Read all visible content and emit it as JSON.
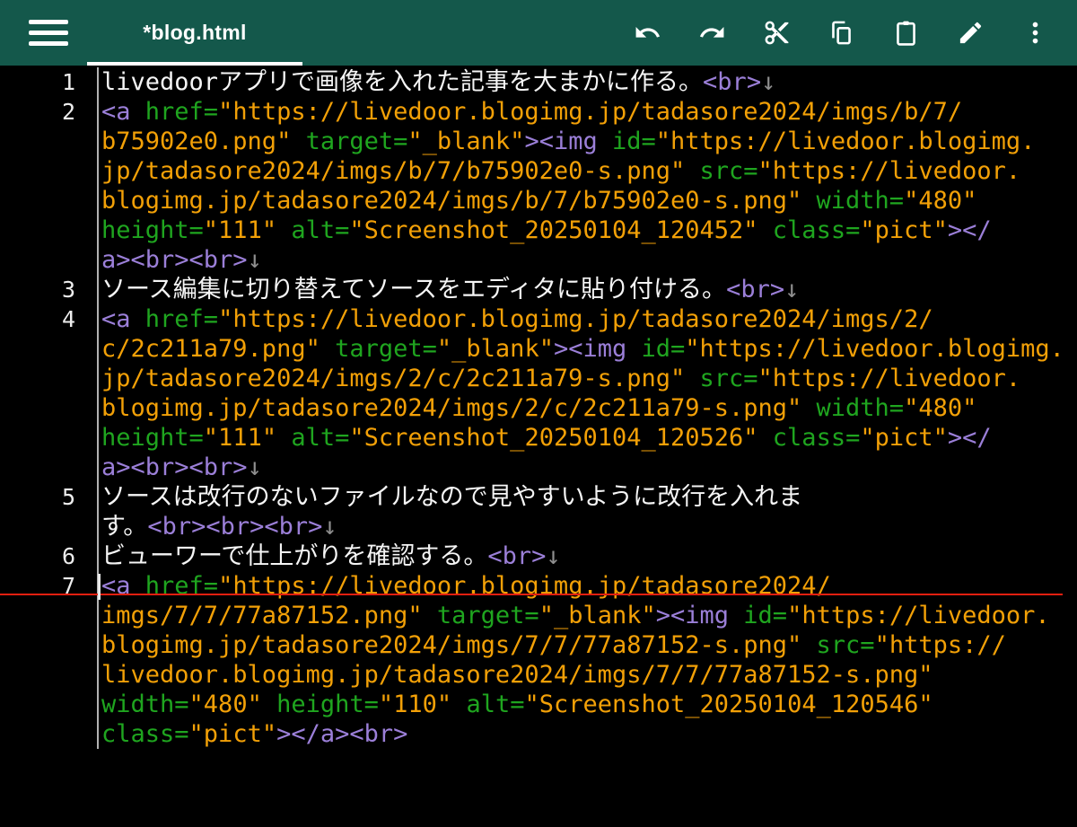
{
  "topbar": {
    "tab_title": "*blog.html",
    "icons": [
      "hamburger-menu",
      "undo",
      "redo",
      "cut",
      "copy",
      "paste",
      "edit",
      "more-vertical"
    ]
  },
  "colors": {
    "topbar_background": "#14584b",
    "editor_background": "#000000",
    "tag": "#9b7fd8",
    "attribute": "#1fa51f",
    "string": "#f2a007",
    "plain_text": "#f5f5f5",
    "line_number": "#ededed",
    "newline_arrow": "#8f8f8f",
    "current_line_underline": "#e11f10"
  },
  "editor": {
    "lines": [
      {
        "number": "1",
        "rows": [
          [
            {
              "t": "livedoorアプリで画像を入れた記事を大まかに作る。",
              "c": "plain"
            },
            {
              "t": "<br>",
              "c": "tag"
            },
            {
              "t": "↓",
              "c": "eol"
            }
          ]
        ]
      },
      {
        "number": "2",
        "rows": [
          [
            {
              "t": "<a",
              "c": "tag"
            },
            {
              "t": " ",
              "c": "plain"
            },
            {
              "t": "href=",
              "c": "attr"
            },
            {
              "t": "\"https://livedoor.blogimg.jp/tadasore2024/imgs/b/7/",
              "c": "str"
            }
          ],
          [
            {
              "t": "b75902e0.png\"",
              "c": "str"
            },
            {
              "t": " ",
              "c": "plain"
            },
            {
              "t": "target=",
              "c": "attr"
            },
            {
              "t": "\"_blank\"",
              "c": "str"
            },
            {
              "t": "><img",
              "c": "tag"
            },
            {
              "t": " ",
              "c": "plain"
            },
            {
              "t": "id=",
              "c": "attr"
            },
            {
              "t": "\"https://livedoor.blogimg.",
              "c": "str"
            }
          ],
          [
            {
              "t": "jp/tadasore2024/imgs/b/7/b75902e0-s.png\"",
              "c": "str"
            },
            {
              "t": " ",
              "c": "plain"
            },
            {
              "t": "src=",
              "c": "attr"
            },
            {
              "t": "\"https://livedoor.",
              "c": "str"
            }
          ],
          [
            {
              "t": "blogimg.jp/tadasore2024/imgs/b/7/b75902e0-s.png\"",
              "c": "str"
            },
            {
              "t": " ",
              "c": "plain"
            },
            {
              "t": "width=",
              "c": "attr"
            },
            {
              "t": "\"480\"",
              "c": "str"
            }
          ],
          [
            {
              "t": "height=",
              "c": "attr"
            },
            {
              "t": "\"111\"",
              "c": "str"
            },
            {
              "t": " ",
              "c": "plain"
            },
            {
              "t": "alt=",
              "c": "attr"
            },
            {
              "t": "\"Screenshot_20250104_120452\"",
              "c": "str"
            },
            {
              "t": " ",
              "c": "plain"
            },
            {
              "t": "class=",
              "c": "attr"
            },
            {
              "t": "\"pict\"",
              "c": "str"
            },
            {
              "t": "></",
              "c": "tag"
            }
          ],
          [
            {
              "t": "a><br><br>",
              "c": "tag"
            },
            {
              "t": "↓",
              "c": "eol"
            }
          ]
        ]
      },
      {
        "number": "3",
        "rows": [
          [
            {
              "t": "ソース編集に切り替えてソースをエディタに貼り付ける。",
              "c": "plain"
            },
            {
              "t": "<br>",
              "c": "tag"
            },
            {
              "t": "↓",
              "c": "eol"
            }
          ]
        ]
      },
      {
        "number": "4",
        "rows": [
          [
            {
              "t": "<a",
              "c": "tag"
            },
            {
              "t": " ",
              "c": "plain"
            },
            {
              "t": "href=",
              "c": "attr"
            },
            {
              "t": "\"https://livedoor.blogimg.jp/tadasore2024/imgs/2/",
              "c": "str"
            }
          ],
          [
            {
              "t": "c/2c211a79.png\"",
              "c": "str"
            },
            {
              "t": " ",
              "c": "plain"
            },
            {
              "t": "target=",
              "c": "attr"
            },
            {
              "t": "\"_blank\"",
              "c": "str"
            },
            {
              "t": "><img",
              "c": "tag"
            },
            {
              "t": " ",
              "c": "plain"
            },
            {
              "t": "id=",
              "c": "attr"
            },
            {
              "t": "\"https://livedoor.blogimg.",
              "c": "str"
            }
          ],
          [
            {
              "t": "jp/tadasore2024/imgs/2/c/2c211a79-s.png\"",
              "c": "str"
            },
            {
              "t": " ",
              "c": "plain"
            },
            {
              "t": "src=",
              "c": "attr"
            },
            {
              "t": "\"https://livedoor.",
              "c": "str"
            }
          ],
          [
            {
              "t": "blogimg.jp/tadasore2024/imgs/2/c/2c211a79-s.png\"",
              "c": "str"
            },
            {
              "t": " ",
              "c": "plain"
            },
            {
              "t": "width=",
              "c": "attr"
            },
            {
              "t": "\"480\"",
              "c": "str"
            }
          ],
          [
            {
              "t": "height=",
              "c": "attr"
            },
            {
              "t": "\"111\"",
              "c": "str"
            },
            {
              "t": " ",
              "c": "plain"
            },
            {
              "t": "alt=",
              "c": "attr"
            },
            {
              "t": "\"Screenshot_20250104_120526\"",
              "c": "str"
            },
            {
              "t": " ",
              "c": "plain"
            },
            {
              "t": "class=",
              "c": "attr"
            },
            {
              "t": "\"pict\"",
              "c": "str"
            },
            {
              "t": "></",
              "c": "tag"
            }
          ],
          [
            {
              "t": "a><br><br>",
              "c": "tag"
            },
            {
              "t": "↓",
              "c": "eol"
            }
          ]
        ]
      },
      {
        "number": "5",
        "rows": [
          [
            {
              "t": "ソースは改行のないファイルなので見やすいように改行を入れま",
              "c": "plain"
            }
          ],
          [
            {
              "t": "す。",
              "c": "plain"
            },
            {
              "t": "<br><br><br>",
              "c": "tag"
            },
            {
              "t": "↓",
              "c": "eol"
            }
          ]
        ]
      },
      {
        "number": "6",
        "rows": [
          [
            {
              "t": "ビューワーで仕上がりを確認する。",
              "c": "plain"
            },
            {
              "t": "<br>",
              "c": "tag"
            },
            {
              "t": "↓",
              "c": "eol"
            }
          ]
        ]
      },
      {
        "number": "7",
        "rows": [
          [
            {
              "t": "<a",
              "c": "tag"
            },
            {
              "t": " ",
              "c": "plain"
            },
            {
              "t": "href=",
              "c": "attr"
            },
            {
              "t": "\"https://livedoor.blogimg.jp/tadasore2024/",
              "c": "str"
            }
          ],
          [
            {
              "t": "imgs/7/7/77a87152.png\"",
              "c": "str"
            },
            {
              "t": " ",
              "c": "plain"
            },
            {
              "t": "target=",
              "c": "attr"
            },
            {
              "t": "\"_blank\"",
              "c": "str"
            },
            {
              "t": "><img",
              "c": "tag"
            },
            {
              "t": " ",
              "c": "plain"
            },
            {
              "t": "id=",
              "c": "attr"
            },
            {
              "t": "\"https://livedoor.",
              "c": "str"
            }
          ],
          [
            {
              "t": "blogimg.jp/tadasore2024/imgs/7/7/77a87152-s.png\"",
              "c": "str"
            },
            {
              "t": " ",
              "c": "plain"
            },
            {
              "t": "src=",
              "c": "attr"
            },
            {
              "t": "\"https://",
              "c": "str"
            }
          ],
          [
            {
              "t": "livedoor.blogimg.jp/tadasore2024/imgs/7/7/77a87152-s.png\"",
              "c": "str"
            }
          ],
          [
            {
              "t": "width=",
              "c": "attr"
            },
            {
              "t": "\"480\"",
              "c": "str"
            },
            {
              "t": " ",
              "c": "plain"
            },
            {
              "t": "height=",
              "c": "attr"
            },
            {
              "t": "\"110\"",
              "c": "str"
            },
            {
              "t": " ",
              "c": "plain"
            },
            {
              "t": "alt=",
              "c": "attr"
            },
            {
              "t": "\"Screenshot_20250104_120546\"",
              "c": "str"
            }
          ],
          [
            {
              "t": "class=",
              "c": "attr"
            },
            {
              "t": "\"pict\"",
              "c": "str"
            },
            {
              "t": "></a><br>",
              "c": "tag"
            }
          ]
        ]
      }
    ]
  }
}
